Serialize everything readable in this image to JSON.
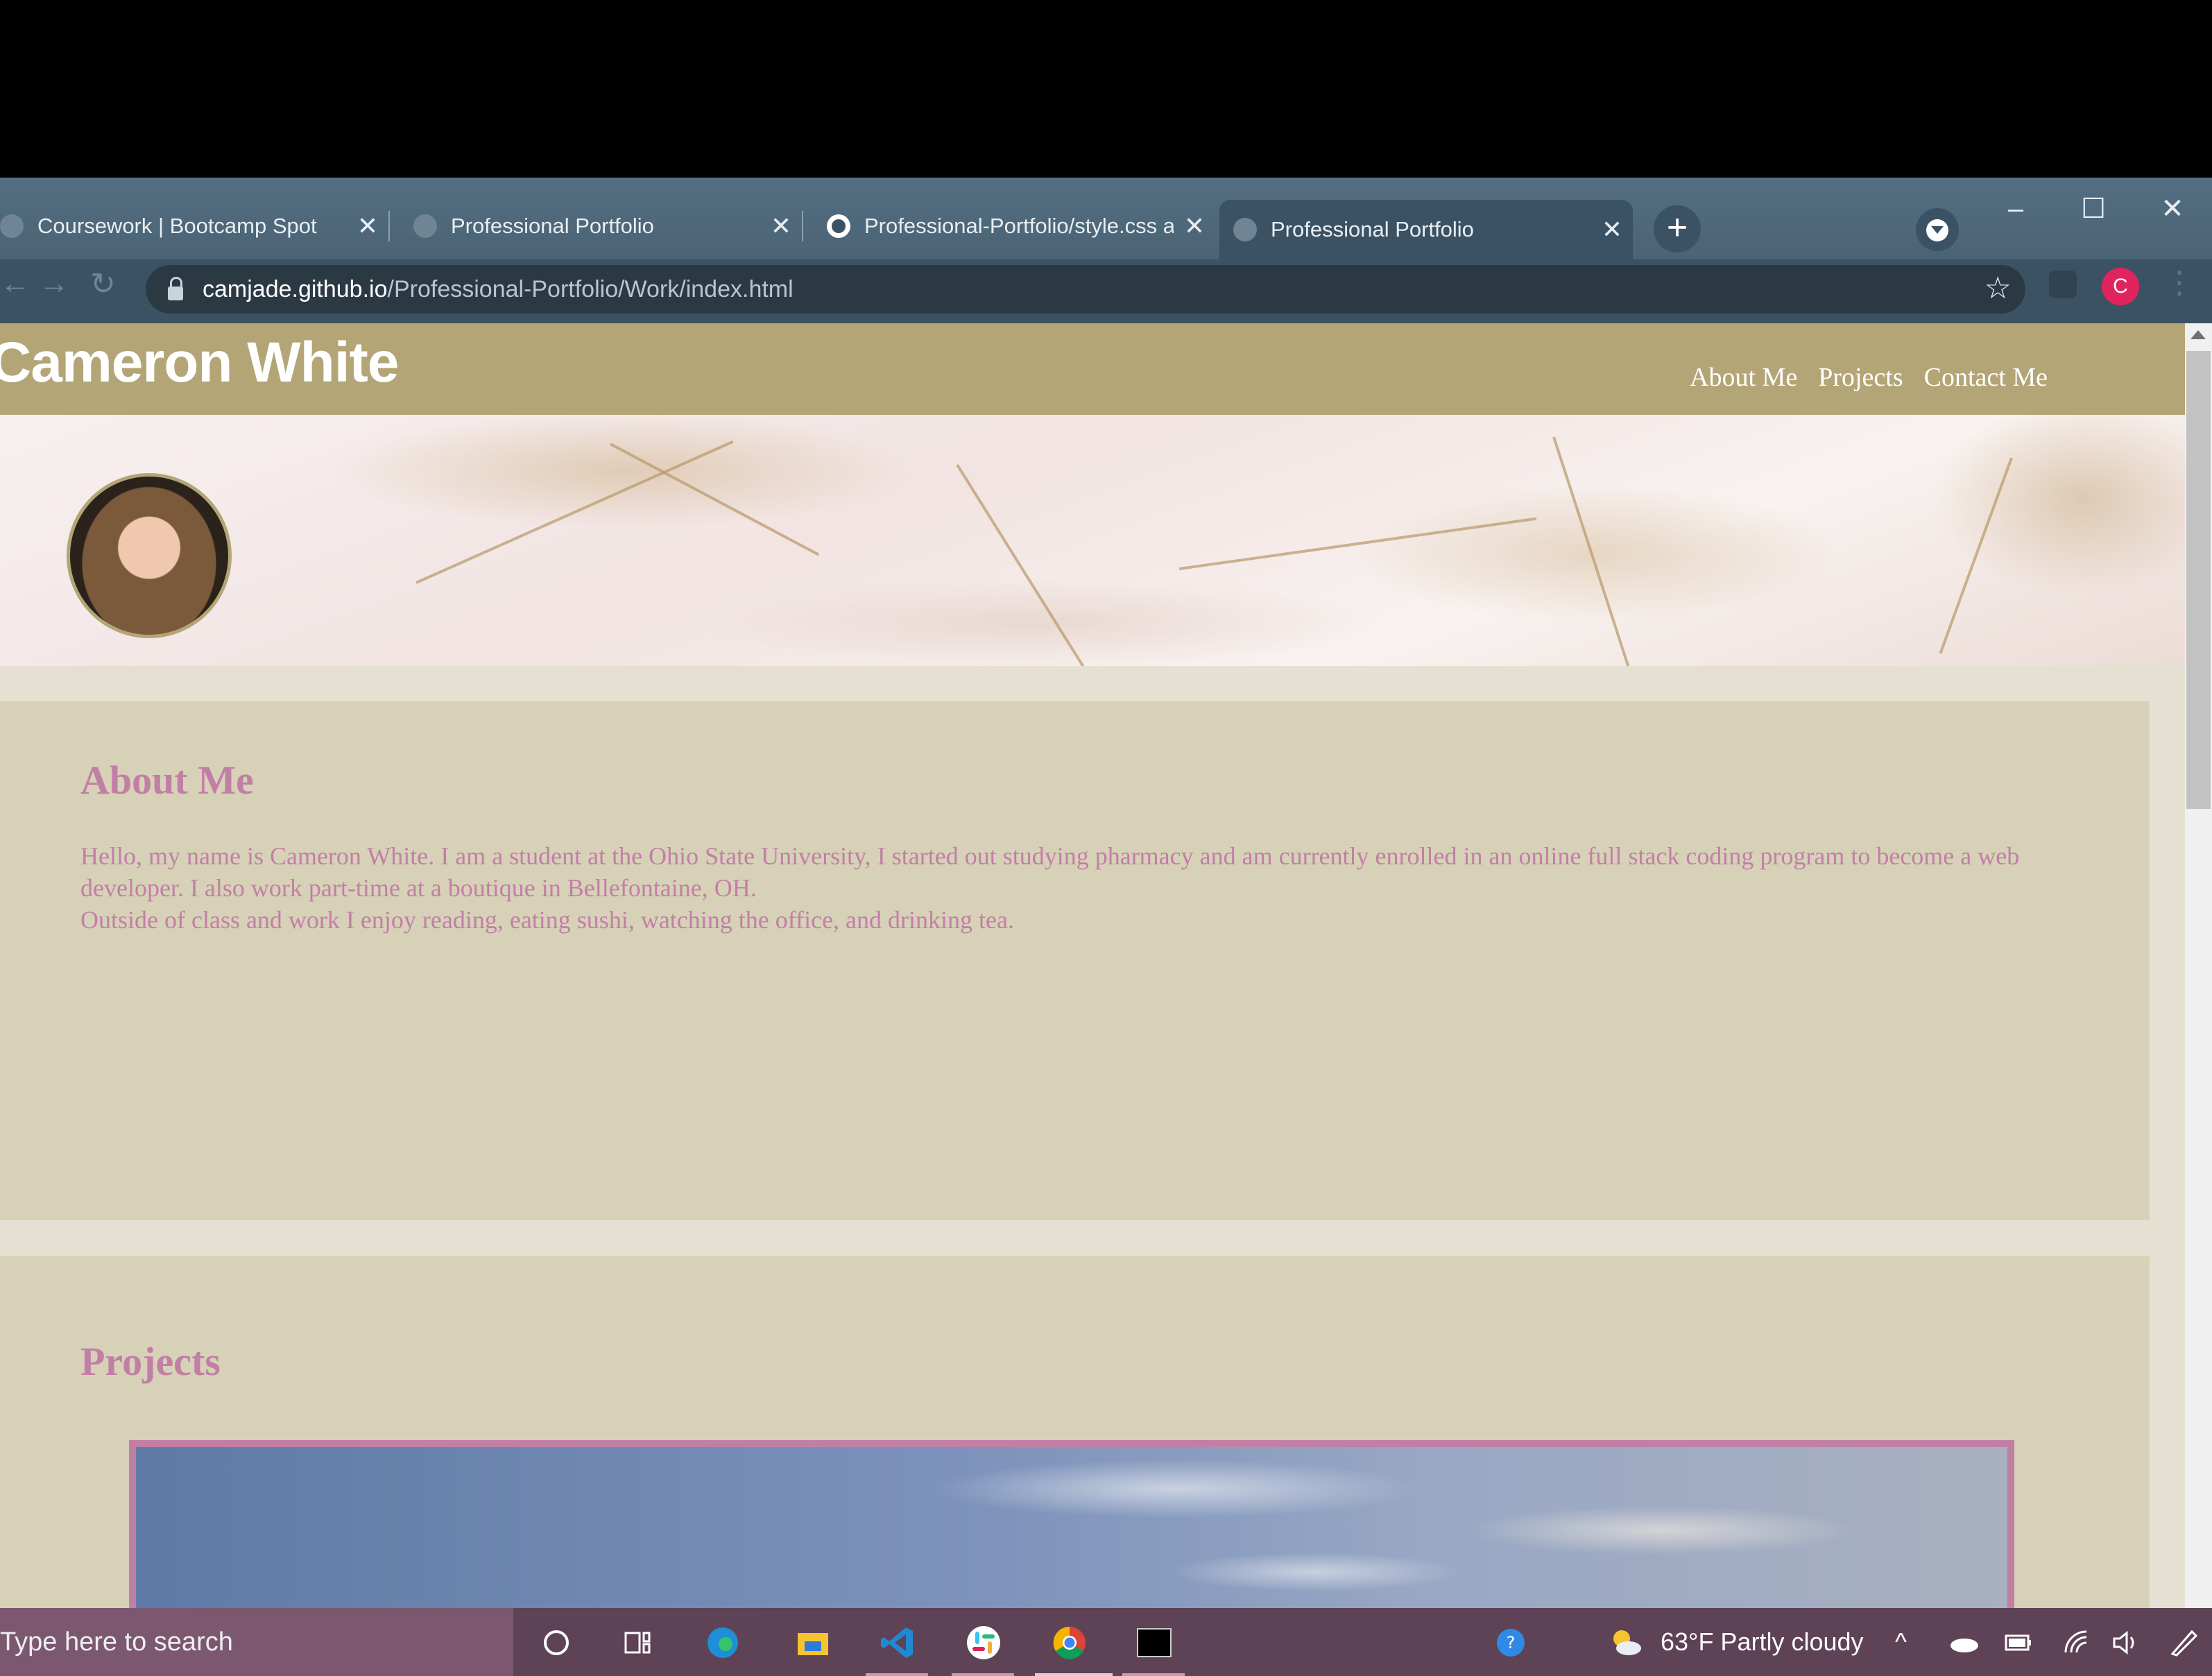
{
  "browser": {
    "tabs": [
      {
        "title": "Coursework | Bootcamp Spot"
      },
      {
        "title": "Professional Portfolio"
      },
      {
        "title": "Professional-Portfolio/style.css at"
      },
      {
        "title": "Professional Portfolio"
      }
    ],
    "url_host": "camjade.github.io",
    "url_path": "/Professional-Portfolio/Work/index.html",
    "profile_initial": "C"
  },
  "site": {
    "title": "Cameron White",
    "nav": [
      "About Me",
      "Projects",
      "Contact Me"
    ],
    "about": {
      "heading": "About Me",
      "paragraphs": [
        "Hello, my name is Cameron White. I am a student at the Ohio State University, I started out studying pharmacy and am currently enrolled in an online full stack coding program to become a web developer. I also work part-time at a boutique in Bellefontaine, OH.",
        "Outside of class and work I enjoy reading, eating sushi, watching the office, and drinking tea."
      ]
    },
    "projects": {
      "heading": "Projects"
    }
  },
  "taskbar": {
    "search_placeholder": "Type here to search",
    "weather": "63°F  Partly cloudy"
  },
  "colors": {
    "header": "#b3a576",
    "accent_pink": "#c27fa6",
    "section_bg": "#d7d1b8",
    "page_bg": "#e6e0d2"
  }
}
